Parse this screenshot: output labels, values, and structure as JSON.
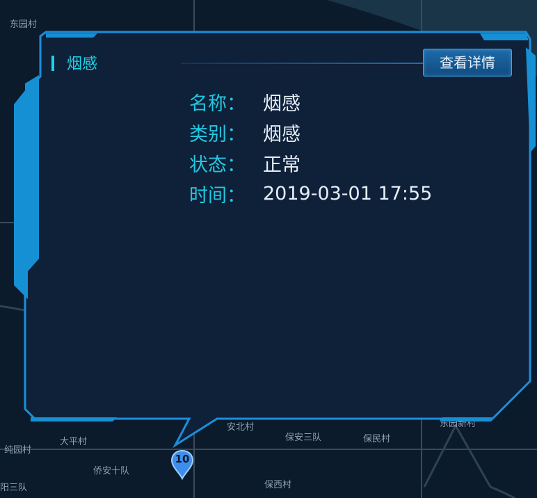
{
  "popup": {
    "title": "烟感",
    "detail_button": "查看详情",
    "fields": [
      {
        "key": "名称：",
        "value": "烟感"
      },
      {
        "key": "类别：",
        "value": "烟感"
      },
      {
        "key": "状态：",
        "value": "正常"
      },
      {
        "key": "时间：",
        "value": "2019-03-01 17:55"
      }
    ]
  },
  "marker": {
    "count": "10"
  },
  "map_labels": [
    "东园村",
    "大平村",
    "纯园村",
    "侨安十队",
    "安北村",
    "保安三队",
    "保民村",
    "保西村",
    "阳三队",
    "东园新村"
  ],
  "colors": {
    "accent_cyan": "#1fd3e8",
    "frame_blue": "#1a8fdc",
    "panel_bg": "#0f2039",
    "map_bg": "#0c1b2c"
  }
}
